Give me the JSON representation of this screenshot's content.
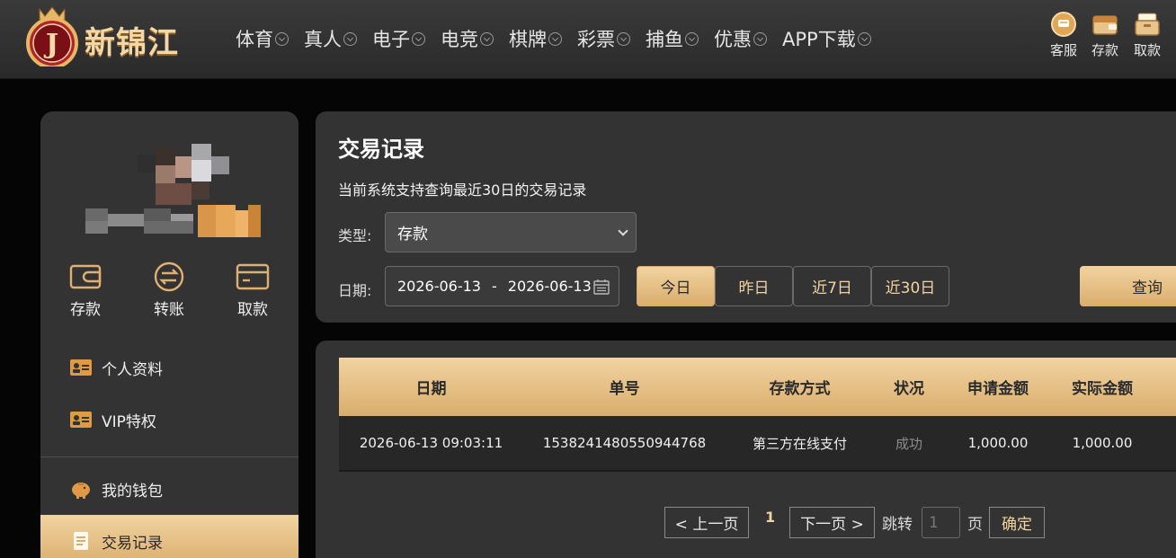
{
  "brand": {
    "name": "新锦江",
    "emblem_letter": "J"
  },
  "nav": [
    {
      "label": "体育"
    },
    {
      "label": "真人"
    },
    {
      "label": "电子"
    },
    {
      "label": "电竞"
    },
    {
      "label": "棋牌"
    },
    {
      "label": "彩票"
    },
    {
      "label": "捕鱼"
    },
    {
      "label": "优惠"
    },
    {
      "label": "APP下载"
    }
  ],
  "quick": {
    "service": "客服",
    "deposit": "存款",
    "withdraw": "取款"
  },
  "sidebar": {
    "actions": {
      "deposit": "存款",
      "transfer": "转账",
      "withdraw": "取款"
    },
    "items": [
      {
        "label": "个人资料"
      },
      {
        "label": "VIP特权"
      },
      {
        "label": "我的钱包"
      },
      {
        "label": "交易记录"
      }
    ]
  },
  "filter": {
    "title": "交易记录",
    "subtitle": "当前系统支持查询最近30日的交易记录",
    "type_label": "类型:",
    "type_value": "存款",
    "date_label": "日期:",
    "date_from": "2026-06-13",
    "date_sep": "-",
    "date_to": "2026-06-13",
    "quick": [
      "今日",
      "昨日",
      "近7日",
      "近30日"
    ],
    "search": "查询"
  },
  "table": {
    "headers": [
      "日期",
      "单号",
      "存款方式",
      "状况",
      "申请金额",
      "实际金额"
    ],
    "rows": [
      [
        "2026-06-13 09:03:11",
        "1538241480550944768",
        "第三方在线支付",
        "成功",
        "1,000.00",
        "1,000.00"
      ]
    ]
  },
  "pager": {
    "prev": "< 上一页",
    "current": "1",
    "next": "下一页 >",
    "jump": "跳转",
    "jump_value": "1",
    "page_unit": "页",
    "confirm": "确定"
  },
  "colors": {
    "gold_light": "#f2d3a1",
    "gold_dark": "#d9ad6d",
    "panel": "#333333"
  }
}
